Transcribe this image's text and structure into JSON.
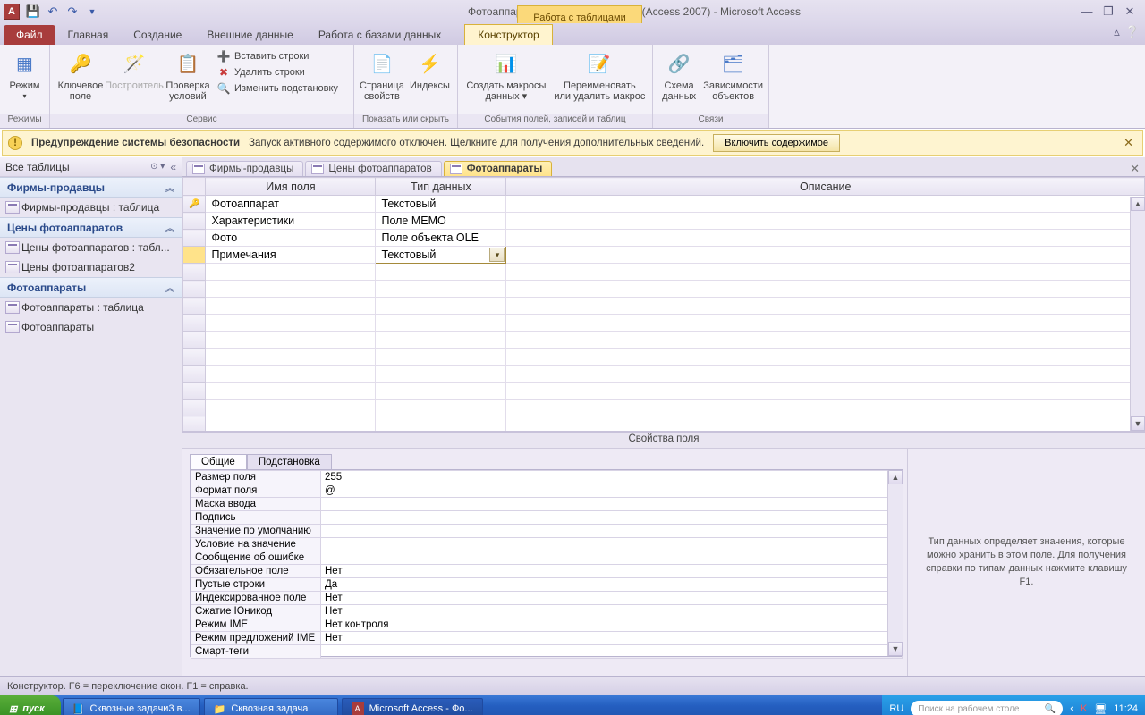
{
  "title": "Фотоаппараты 2010 : база данных (Access 2007)  -  Microsoft Access",
  "context_tab_title": "Работа с таблицами",
  "app_letter": "А",
  "tabs": {
    "file": "Файл",
    "home": "Главная",
    "create": "Создание",
    "external": "Внешние данные",
    "dbtools": "Работа с базами данных",
    "designer": "Конструктор"
  },
  "ribbon": {
    "groups": {
      "views": {
        "label": "Режимы",
        "view": "Режим"
      },
      "tools": {
        "label": "Сервис",
        "key": "Ключевое\nполе",
        "builder": "Построитель",
        "validation": "Проверка\nусловий",
        "insert_rows": "Вставить строки",
        "delete_rows": "Удалить строки",
        "modify_lookup": "Изменить подстановку"
      },
      "showhide": {
        "label": "Показать или скрыть",
        "propsheet": "Страница\nсвойств",
        "indexes": "Индексы"
      },
      "events": {
        "label": "События полей, записей и таблиц",
        "create_macros": "Создать макросы\nданных ▾",
        "rename_delete": "Переименовать\nили удалить макрос"
      },
      "relations": {
        "label": "Связи",
        "schema": "Схема\nданных",
        "deps": "Зависимости\nобъектов"
      }
    }
  },
  "msgbar": {
    "title": "Предупреждение системы безопасности",
    "text": "Запуск активного содержимого отключен. Щелкните для получения дополнительных сведений.",
    "button": "Включить содержимое"
  },
  "nav": {
    "header": "Все таблицы",
    "g1": "Фирмы-продавцы",
    "g1i1": "Фирмы-продавцы : таблица",
    "g2": "Цены фотоаппаратов",
    "g2i1": "Цены фотоаппаратов : табл...",
    "g2i2": "Цены фотоаппаратов2",
    "g3": "Фотоаппараты",
    "g3i1": "Фотоаппараты : таблица",
    "g3i2": "Фотоаппараты"
  },
  "doctabs": {
    "t1": "Фирмы-продавцы",
    "t2": "Цены фотоаппаратов",
    "t3": "Фотоаппараты"
  },
  "grid_headers": {
    "name": "Имя поля",
    "type": "Тип данных",
    "desc": "Описание"
  },
  "fields": [
    {
      "name": "Фотоаппарат",
      "type": "Текстовый"
    },
    {
      "name": "Характеристики",
      "type": "Поле МЕМО"
    },
    {
      "name": "Фото",
      "type": "Поле объекта OLE"
    },
    {
      "name": "Примечания",
      "type": "Текстовый"
    }
  ],
  "splitter_label": "Свойства поля",
  "prop_tabs": {
    "general": "Общие",
    "lookup": "Подстановка"
  },
  "props": {
    "size_l": "Размер поля",
    "size_v": "255",
    "format_l": "Формат поля",
    "format_v": "@",
    "mask_l": "Маска ввода",
    "mask_v": "",
    "caption_l": "Подпись",
    "caption_v": "",
    "default_l": "Значение по умолчанию",
    "default_v": "",
    "rule_l": "Условие на значение",
    "rule_v": "",
    "msg_l": "Сообщение об ошибке",
    "msg_v": "",
    "required_l": "Обязательное поле",
    "required_v": "Нет",
    "zerolen_l": "Пустые строки",
    "zerolen_v": "Да",
    "indexed_l": "Индексированное поле",
    "indexed_v": "Нет",
    "unicode_l": "Сжатие Юникод",
    "unicode_v": "Нет",
    "ime_l": "Режим IME",
    "ime_v": "Нет контроля",
    "imesent_l": "Режим предложений IME",
    "imesent_v": "Нет",
    "smart_l": "Смарт-теги",
    "smart_v": ""
  },
  "prop_help": "Тип данных определяет значения, которые можно хранить в этом поле. Для получения справки по типам данных нажмите клавишу F1.",
  "statusbar": "Конструктор.   F6 = переключение окон.   F1 = справка.",
  "taskbar": {
    "start": "пуск",
    "item1": "Сквозные задачи3 в...",
    "item2": "Сквозная задача",
    "item3": "Microsoft Access - Фо...",
    "lang": "RU",
    "search_ph": "Поиск на рабочем столе",
    "time": "11:24"
  }
}
